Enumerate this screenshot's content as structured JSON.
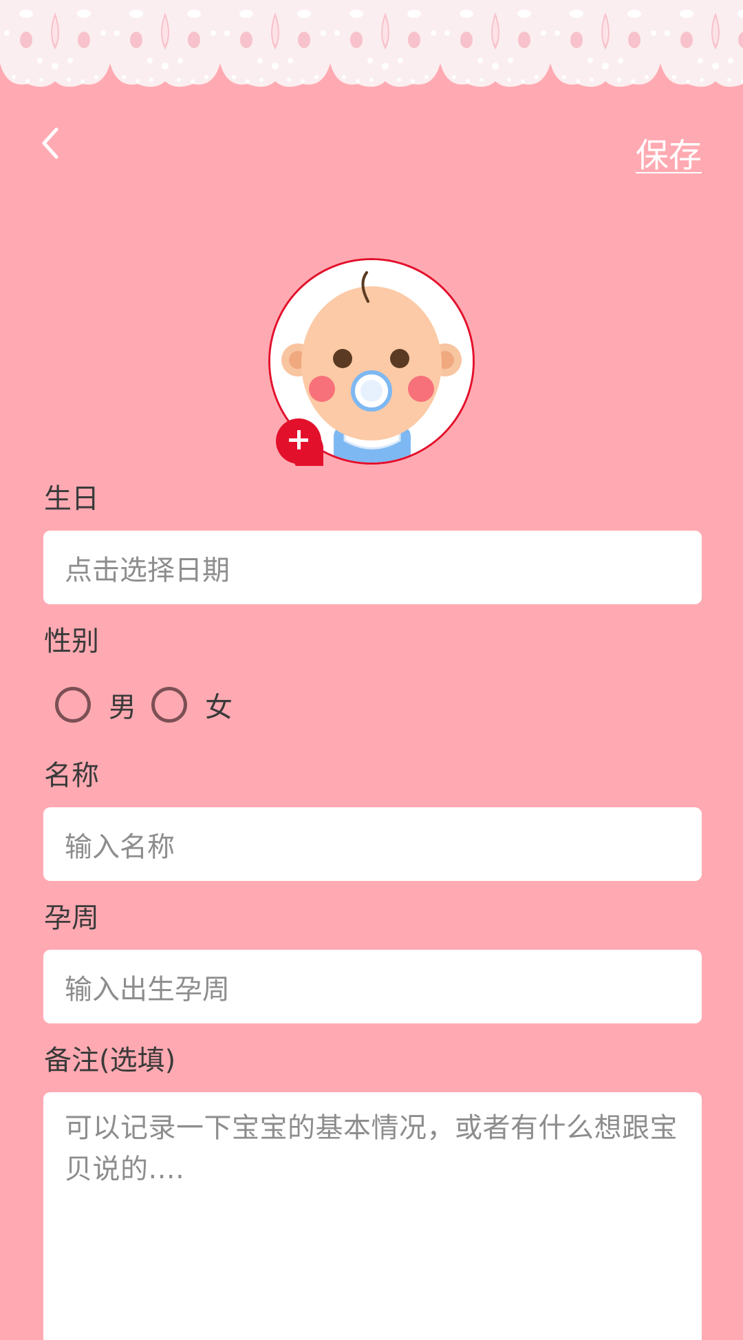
{
  "colors": {
    "background": "#ffaab2",
    "accent": "#e3102c",
    "field_bg": "#ffffff",
    "radio_border": "#7c5055"
  },
  "header": {
    "back_icon": "chevron-left-icon",
    "save_label": "保存"
  },
  "avatar": {
    "image": "baby-face-with-pacifier",
    "add_icon": "plus-icon"
  },
  "form": {
    "birthday": {
      "label": "生日",
      "placeholder": "点击选择日期"
    },
    "gender": {
      "label": "性别",
      "options": [
        "男",
        "女"
      ]
    },
    "name": {
      "label": "名称",
      "placeholder": "输入名称"
    },
    "gestation": {
      "label": "孕周",
      "placeholder": "输入出生孕周"
    },
    "notes": {
      "label": "备注(选填)",
      "placeholder": "可以记录一下宝宝的基本情况，或者有什么想跟宝贝说的...."
    }
  }
}
